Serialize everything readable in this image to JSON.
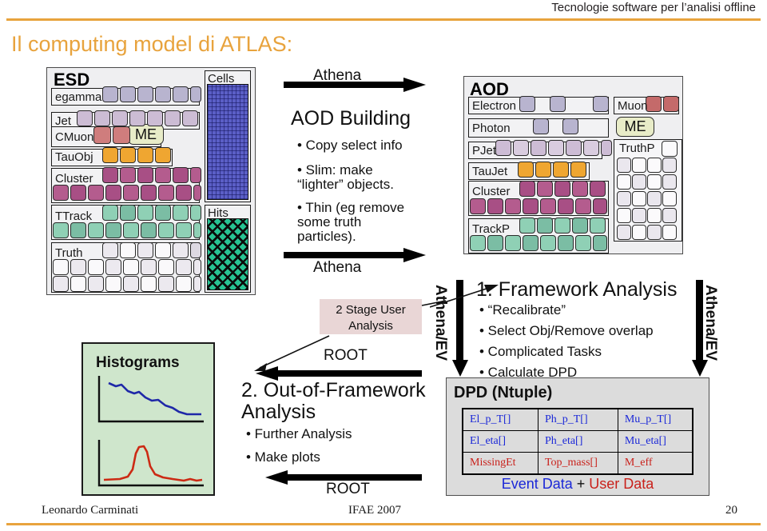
{
  "header": {
    "running_title": "Tecnologie software per l’analisi offline"
  },
  "slide": {
    "title": "Il computing model di ATLAS:"
  },
  "footer": {
    "author": "Leonardo Carminati",
    "conference": "IFAE 2007",
    "page_number": "20"
  },
  "esd_panel": {
    "title": "ESD",
    "rows": [
      {
        "label": "egamma",
        "color": "#b8b4cf",
        "count": 6
      },
      {
        "label": "Jet",
        "color": "#ccbcd4",
        "count": 7
      },
      {
        "label": "CMuon",
        "color": "#cf7d7d",
        "count": 2
      },
      {
        "label": "TauObj",
        "color": "#efa631",
        "count": 4
      },
      {
        "label": "Cluster",
        "color": "#a84f85",
        "count": 15
      },
      {
        "label": "TTrack",
        "color": "#87c9ae",
        "count": 16
      },
      {
        "label": "Truth",
        "color": "#ece9ef",
        "count": 24
      }
    ],
    "me_label": "ME",
    "cells_label": "Cells",
    "hits_label": "Hits",
    "cells_color": "#5b5fc7",
    "hits_color": "#27c393"
  },
  "aod_panel": {
    "title": "AOD",
    "rows": [
      {
        "label": "Electron",
        "color": "#b8b4cf",
        "count": 3
      },
      {
        "label": "Photon",
        "color": "#b8b4cf",
        "count": 2
      },
      {
        "label": "PJet",
        "color": "#ccbcd4",
        "count": 7
      },
      {
        "label": "TauJet",
        "color": "#efa631",
        "count": 4
      },
      {
        "label": "Cluster",
        "color": "#a84f85",
        "count": 14
      },
      {
        "label": "TrackP",
        "color": "#87c9ae",
        "count": 14
      },
      {
        "label": "Muon",
        "color": "#cf7d7d",
        "count": 2
      },
      {
        "label": "TruthP",
        "color": "#ece9ef",
        "count": 21
      }
    ],
    "me_label": "ME"
  },
  "aod_building": {
    "top_arrow_label": "Athena",
    "heading": "AOD Building",
    "bullets": [
      "• Copy select info",
      "• Slim: make",
      "“lighter” objects.",
      "• Thin (eg remove",
      "some truth",
      "particles)."
    ],
    "bottom_arrow_label": "Athena"
  },
  "callout": {
    "line1": "2 Stage User",
    "line2": "Analysis"
  },
  "out_of_framework": {
    "arrow_label_top": "ROOT",
    "heading_line1": "2. Out-of-Framework",
    "heading_line2": "Analysis",
    "bullets": [
      "• Further Analysis",
      "• Make plots"
    ],
    "arrow_label_bottom": "ROOT"
  },
  "framework_analysis": {
    "heading": "1.  Framework Analysis",
    "bullets": [
      "• “Recalibrate”",
      "• Select Obj/Remove overlap",
      "• Complicated Tasks",
      "• Calculate DPD"
    ],
    "left_vertical_label": "Athena/EV",
    "right_vertical_label": "Athena/EV"
  },
  "histograms": {
    "title": "Histograms",
    "curve_colors": {
      "upper": "#1f28a8",
      "lower": "#cc2a14"
    }
  },
  "dpd": {
    "title": "DPD (Ntuple)",
    "rows": [
      [
        {
          "text": "El_p_T[]",
          "kind": "event"
        },
        {
          "text": "Ph_p_T[]",
          "kind": "event"
        },
        {
          "text": "Mu_p_T[]",
          "kind": "event"
        }
      ],
      [
        {
          "text": "El_eta[]",
          "kind": "event"
        },
        {
          "text": "Ph_eta[]",
          "kind": "event"
        },
        {
          "text": "Mu_eta[]",
          "kind": "event"
        }
      ],
      [
        {
          "text": "MissingEt",
          "kind": "user"
        },
        {
          "text": "Top_mass[]",
          "kind": "user"
        },
        {
          "text": "M_eff",
          "kind": "user"
        }
      ]
    ],
    "footer_event": "Event Data",
    "footer_plus": " + ",
    "footer_user": "User Data",
    "event_color": "#1b28d8",
    "user_color": "#c9211b"
  },
  "colors": {
    "accent_rule": "#e8a33d",
    "title": "#e8a33d"
  }
}
